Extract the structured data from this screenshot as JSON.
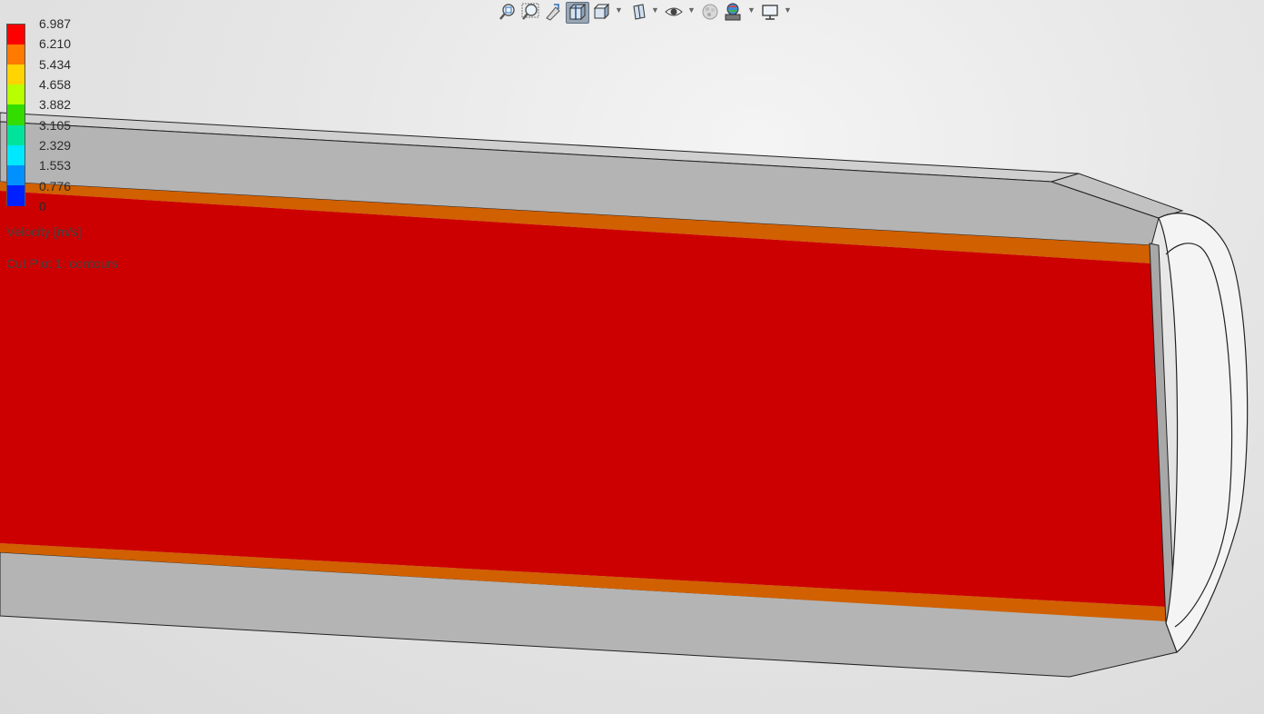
{
  "toolbar": {
    "items": [
      {
        "name": "zoom-to-fit-icon"
      },
      {
        "name": "zoom-to-area-icon"
      },
      {
        "name": "previous-view-icon"
      },
      {
        "name": "section-view-icon"
      },
      {
        "name": "view-orientation-icon"
      },
      {
        "name": "display-style-icon"
      },
      {
        "name": "hide-show-items-icon"
      },
      {
        "name": "edit-appearance-icon"
      },
      {
        "name": "apply-scene-icon"
      },
      {
        "name": "view-settings-icon"
      }
    ]
  },
  "legend": {
    "values": [
      "6.987",
      "6.210",
      "5.434",
      "4.658",
      "3.882",
      "3.105",
      "2.329",
      "1.553",
      "0.776",
      "0"
    ],
    "colors": [
      "#ff0000",
      "#ff7a00",
      "#ffd400",
      "#b8ff00",
      "#33dd00",
      "#00e39a",
      "#00e8ff",
      "#0090ff",
      "#0020ff"
    ],
    "quantity": "Velocity [m/s]",
    "plot_name": "Cut Plot 1: contours"
  },
  "scene": {
    "pipe_color": "#b8b8b8",
    "velocity_core_color": "#cc0000",
    "velocity_wall_color": "#d06000",
    "cap_color": "#f4f4f4"
  }
}
